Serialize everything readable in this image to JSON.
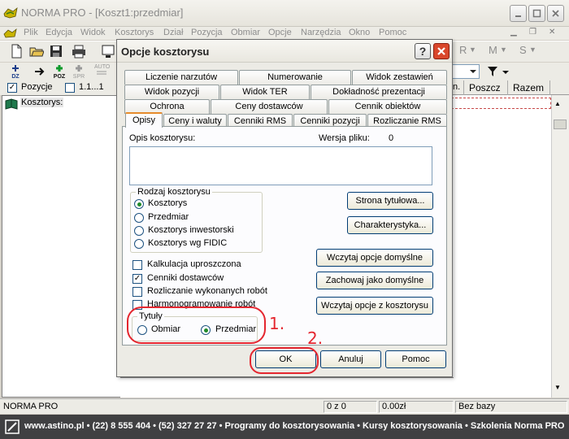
{
  "app": {
    "title": "NORMA PRO - [Koszt1:przedmiar]"
  },
  "menu": [
    "Plik",
    "Edycja",
    "Widok",
    "Kosztorys",
    "Dział",
    "Pozycja",
    "Obmiar",
    "Opcje",
    "Narzędzia",
    "Okno",
    "Pomoc"
  ],
  "toolbar": {
    "icons": [
      "new-file-icon",
      "open-folder-icon",
      "save-icon",
      "print-icon",
      "monitor-icon",
      "dz-icon",
      "arrow-right-icon",
      "poz-icon",
      "spr-icon",
      "auto-icon"
    ],
    "small_labels": {
      "dz": "DZ",
      "poz": "POZ",
      "spr": "SPR",
      "auto": "AUTO"
    },
    "right_menu": [
      "R",
      "M",
      "S"
    ]
  },
  "view_bar": {
    "pozycje_label": "Pozycje",
    "level_label": "1.1...1"
  },
  "tree": {
    "root_label": "Kosztorys:"
  },
  "table_headers": [
    "n.",
    "Poszcz",
    "Razem"
  ],
  "status": {
    "left": "NORMA PRO",
    "count": "0 z 0",
    "amount": "0.00zł",
    "base": "Bez bazy"
  },
  "footer": {
    "text": "www.astino.pl  •  (22) 8 555 404  •  (52) 327 27 27  •  Programy do kosztorysowania  •  Kursy kosztorysowania  •  Szkolenia Norma PRO"
  },
  "dialog": {
    "title": "Opcje kosztorysu",
    "tabs_row1": [
      "Liczenie narzutów",
      "Numerowanie",
      "Widok zestawień"
    ],
    "tabs_row2": [
      "Widok pozycji",
      "Widok TER",
      "Dokładność prezentacji"
    ],
    "tabs_row3": [
      "Ochrona",
      "Ceny dostawców",
      "Cennik obiektów"
    ],
    "tabs_row4": [
      "Opisy",
      "Ceny i waluty",
      "Cenniki RMS",
      "Cenniki pozycji",
      "Rozliczanie RMS"
    ],
    "active_tab": "Opisy",
    "opis_label": "Opis kosztorysu:",
    "wersja_label": "Wersja pliku:",
    "wersja_value": "0",
    "opis_value": "",
    "rodzaj_group": "Rodzaj kosztorysu",
    "rodzaj_options": [
      {
        "label": "Kosztorys",
        "checked": true
      },
      {
        "label": "Przedmiar",
        "checked": false
      },
      {
        "label": "Kosztorys inwestorski",
        "checked": false
      },
      {
        "label": "Kosztorys wg FIDIC",
        "checked": false
      }
    ],
    "checkboxes": [
      {
        "label": "Kalkulacja uproszczona",
        "checked": false
      },
      {
        "label": "Cenniki dostawców",
        "checked": true
      },
      {
        "label": "Rozliczanie wykonanych robót",
        "checked": false
      },
      {
        "label": "Harmonogramowanie robót",
        "checked": false
      }
    ],
    "tytuly_group": "Tytuły",
    "tytuly_options": [
      {
        "label": "Obmiar",
        "checked": false
      },
      {
        "label": "Przedmiar",
        "checked": true
      }
    ],
    "right_buttons": [
      "Strona tytułowa...",
      "Charakterystyka...",
      "Wczytaj opcje domyślne",
      "Zachowaj jako domyślne",
      "Wczytaj opcje z kosztorysu"
    ],
    "ok": "OK",
    "cancel": "Anuluj",
    "help": "Pomoc"
  },
  "annotations": {
    "one": "1.",
    "two": "2."
  },
  "colors": {
    "annotation": "#e4262f",
    "footer_bg": "#404042",
    "close_btn": "#d9472b"
  }
}
